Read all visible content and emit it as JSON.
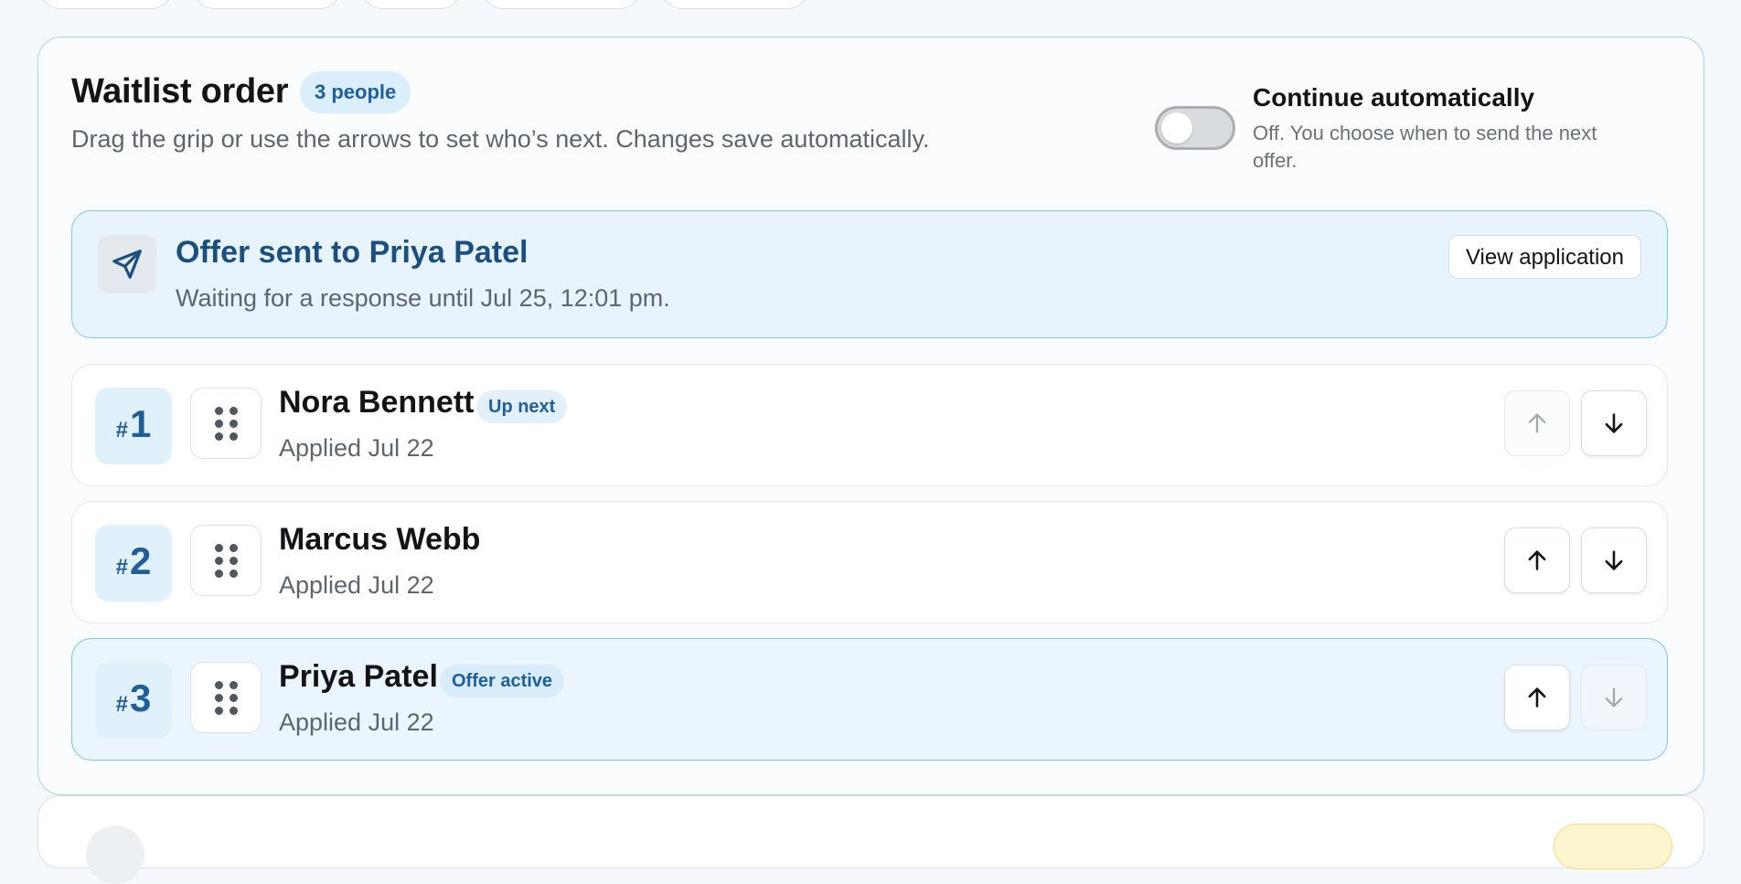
{
  "waitlist": {
    "title": "Waitlist order",
    "count_badge": "3 people",
    "subtitle": "Drag the grip or use the arrows to set who’s next. Changes save automatically."
  },
  "auto_continue": {
    "title": "Continue automatically",
    "description": "Off. You choose when to send the next offer.",
    "enabled": false
  },
  "offer": {
    "icon": "send-icon",
    "title": "Offer sent to Priya Patel",
    "subtitle": "Waiting for a response until Jul 25, 12:01 pm.",
    "view_button": "View application"
  },
  "rows": [
    {
      "hash": "#",
      "rank": "1",
      "name": "Nora Bennett",
      "tag": "Up next",
      "applied": "Applied Jul 22",
      "up_enabled": false,
      "down_enabled": true
    },
    {
      "hash": "#",
      "rank": "2",
      "name": "Marcus Webb",
      "tag": "",
      "applied": "Applied Jul 22",
      "up_enabled": true,
      "down_enabled": true
    },
    {
      "hash": "#",
      "rank": "3",
      "name": "Priya Patel",
      "tag": "Offer active",
      "applied": "Applied Jul 22",
      "up_enabled": true,
      "down_enabled": false
    }
  ],
  "colors": {
    "accent": "#1f5f9e",
    "panel_border": "#a9d2ee",
    "active_row_bg": "#eaf5fd"
  }
}
